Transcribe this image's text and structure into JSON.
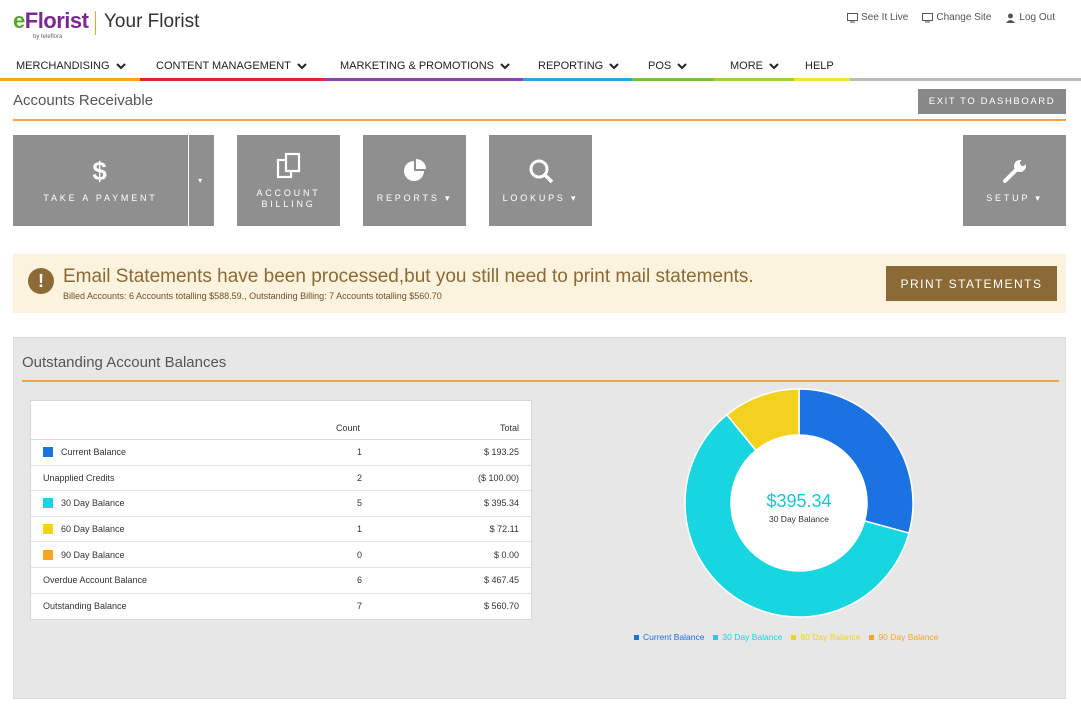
{
  "header": {
    "logo_prefix": "e",
    "logo_rest": "Florist",
    "logo_tagline": "by teleflora",
    "site_name": "Your Florist",
    "links": [
      {
        "label": "See It Live",
        "icon": "monitor-icon"
      },
      {
        "label": "Change Site",
        "icon": "monitor-icon"
      },
      {
        "label": "Log Out",
        "icon": "user-icon"
      }
    ]
  },
  "nav": [
    {
      "label": "MERCHANDISING",
      "color": "#f5a623",
      "dropdown": true
    },
    {
      "label": "CONTENT MANAGEMENT",
      "color": "#e0262d",
      "dropdown": true
    },
    {
      "label": "MARKETING & PROMOTIONS",
      "color": "#8e44ad",
      "dropdown": true
    },
    {
      "label": "REPORTING",
      "color": "#29a8df",
      "dropdown": true
    },
    {
      "label": "POS",
      "color": "#7ac143",
      "dropdown": true
    },
    {
      "label": "MORE",
      "color": "#a6ce39",
      "dropdown": true
    },
    {
      "label": "HELP",
      "color": "#f5e52a",
      "dropdown": false
    }
  ],
  "page": {
    "title": "Accounts Receivable",
    "exit_label": "EXIT TO DASHBOARD"
  },
  "tiles": {
    "payment": {
      "label": "TAKE A PAYMENT",
      "icon": "dollar-icon"
    },
    "billing": {
      "line1": "ACCOUNT",
      "line2": "BILLING",
      "icon": "documents-icon"
    },
    "reports": {
      "label": "REPORTS",
      "icon": "pie-chart-icon"
    },
    "lookups": {
      "label": "LOOKUPS",
      "icon": "search-icon"
    },
    "setup": {
      "label": "SETUP",
      "icon": "wrench-icon"
    },
    "caret": "▾"
  },
  "alert": {
    "icon_glyph": "!",
    "title": "Email Statements have been processed,but you still need to print mail statements.",
    "subtitle": "Billed Accounts: 6 Accounts totalling $588.59., Outstanding Billing: 7 Accounts totalling $560.70",
    "button_label": "PRINT STATEMENTS"
  },
  "panel": {
    "title": "Outstanding Account Balances",
    "columns": {
      "count": "Count",
      "total": "Total"
    },
    "rows": [
      {
        "label": "Current Balance",
        "count": "1",
        "total": "$ 193.25",
        "color": "#1a73e0"
      },
      {
        "label": "Unapplied Credits",
        "count": "2",
        "total": "($ 100.00)",
        "color": ""
      },
      {
        "label": "30 Day Balance",
        "count": "5",
        "total": "$ 395.34",
        "color": "#17d6e0"
      },
      {
        "label": "60 Day Balance",
        "count": "1",
        "total": "$ 72.11",
        "color": "#f2d21e"
      },
      {
        "label": "90 Day Balance",
        "count": "0",
        "total": "$ 0.00",
        "color": "#f5a623"
      },
      {
        "label": "Overdue Account Balance",
        "count": "6",
        "total": "$ 467.45",
        "color": ""
      },
      {
        "label": "Outstanding Balance",
        "count": "7",
        "total": "$ 560.70",
        "color": ""
      }
    ]
  },
  "chart_data": {
    "type": "pie",
    "donut": true,
    "center_value": "$395.34",
    "center_label": "30 Day Balance",
    "legend_position": "bottom",
    "series": [
      {
        "name": "Current Balance",
        "value": 193.25,
        "color": "#1a73e0"
      },
      {
        "name": "30 Day Balance",
        "value": 395.34,
        "color": "#17d6e0"
      },
      {
        "name": "60 Day Balance",
        "value": 72.11,
        "color": "#f2d21e"
      },
      {
        "name": "90 Day Balance",
        "value": 0.0,
        "color": "#f5a623"
      }
    ]
  }
}
